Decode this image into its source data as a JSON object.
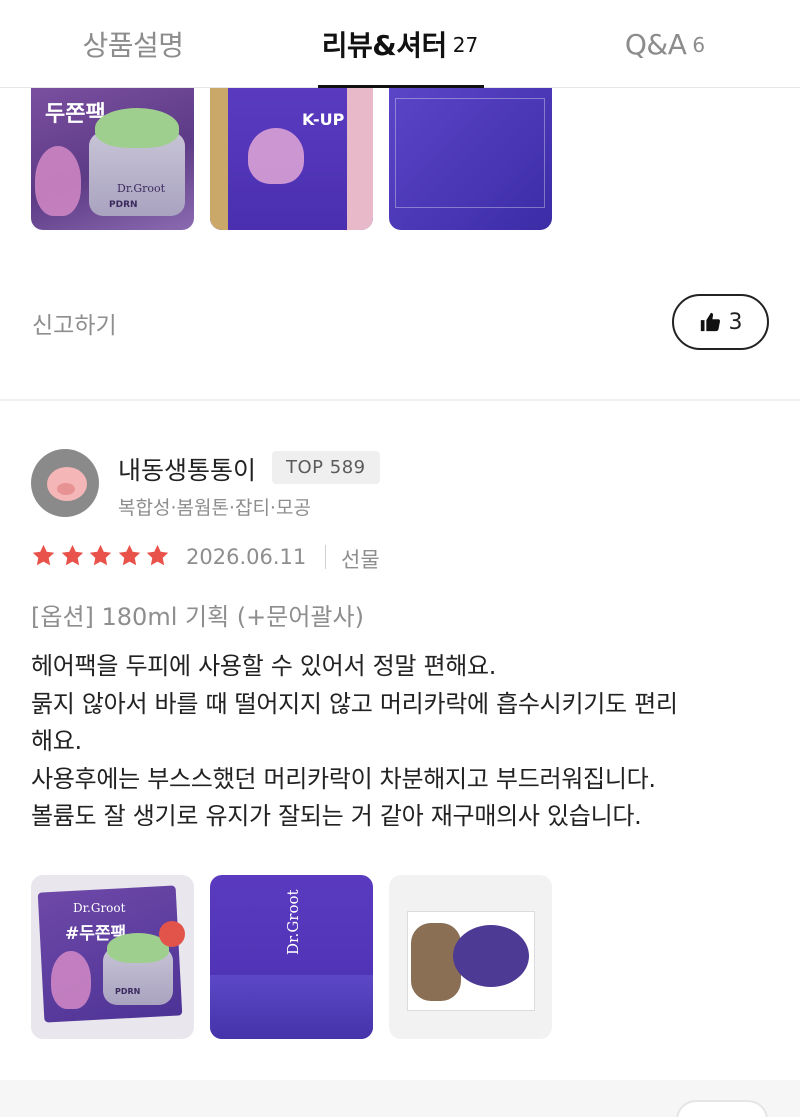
{
  "tabs": [
    {
      "label": "상품설명",
      "count": ""
    },
    {
      "label": "리뷰&셔터",
      "count": "27"
    },
    {
      "label": "Q&A",
      "count": "6"
    }
  ],
  "active_tab": 1,
  "prev_review": {
    "photos": [
      {
        "brand": "Dr.Groot",
        "subbrand": "PDRN",
        "tag": "두쫀팩"
      },
      {
        "tag": "K-UP"
      },
      {}
    ],
    "report_label": "신고하기",
    "likes": "3"
  },
  "review": {
    "username": "내동생통통이",
    "rank_badge": "TOP 589",
    "skin_tags": "복합성·봄웜톤·잡티·모공",
    "rating": 5,
    "star_color": "#e8524a",
    "date": "2026.06.11",
    "purchase_type": "선물",
    "option": "[옵션] 180ml 기획 (+문어괄사)",
    "body_lines": [
      "헤어팩을 두피에 사용할 수 있어서 정말 편해요.",
      "묽지 않아서 바를 때 떨어지지 않고 머리카락에 흡수시키기도 편리",
      "해요.",
      "사용후에는 부스스했던 머리카락이 차분해지고 부드러워집니다.",
      "볼륨도 잘 생기로 유지가 잘되는 거 같아 재구매의사 있습니다."
    ],
    "photos": [
      {
        "brand": "Dr.Groot",
        "tag": "#두쫀팩",
        "subbrand": "PDRN"
      },
      {
        "brand": "Dr.Groot"
      },
      {}
    ]
  },
  "icons": {
    "like": "thumbs-up-icon",
    "star": "star-icon"
  }
}
